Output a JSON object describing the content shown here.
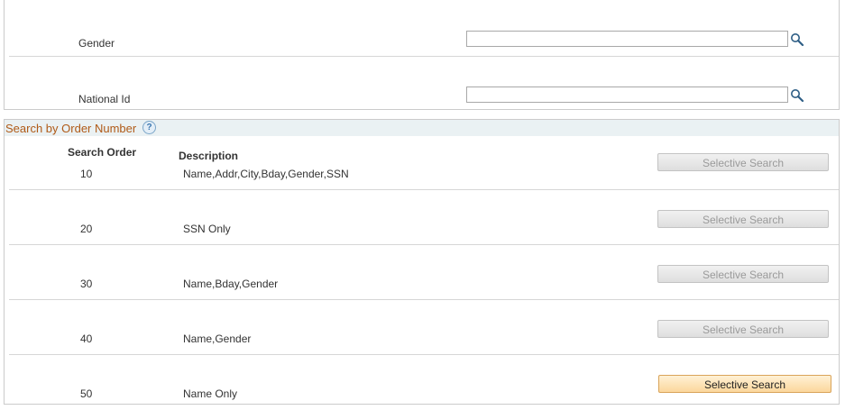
{
  "fields": [
    {
      "label": "Gender",
      "value": ""
    },
    {
      "label": "National Id",
      "value": ""
    }
  ],
  "search_by_order": {
    "title": "Search by Order Number",
    "help_icon": "?",
    "columns": {
      "order": "Search Order",
      "description": "Description"
    },
    "rows": [
      {
        "order": "10",
        "description": "Name,Addr,City,Bday,Gender,SSN",
        "button": "Selective Search",
        "enabled": false
      },
      {
        "order": "20",
        "description": "SSN Only",
        "button": "Selective Search",
        "enabled": false
      },
      {
        "order": "30",
        "description": "Name,Bday,Gender",
        "button": "Selective Search",
        "enabled": false
      },
      {
        "order": "40",
        "description": "Name,Gender",
        "button": "Selective Search",
        "enabled": false
      },
      {
        "order": "50",
        "description": "Name Only",
        "button": "Selective Search",
        "enabled": true
      }
    ]
  }
}
